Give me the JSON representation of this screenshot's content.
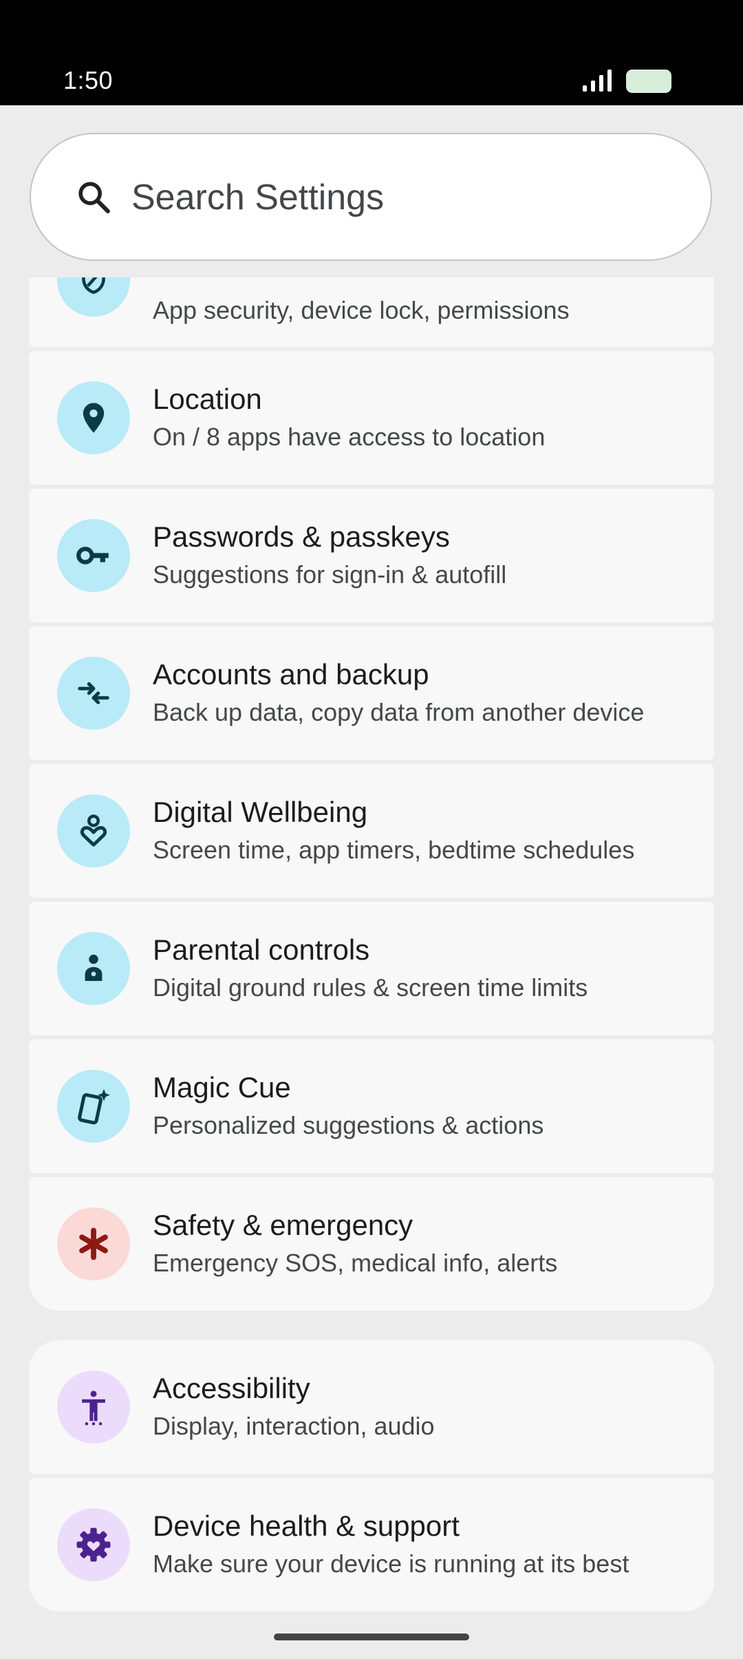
{
  "status_bar": {
    "time": "1:50"
  },
  "search": {
    "placeholder": "Search Settings"
  },
  "colors": {
    "teal_circle": "#b9eaf7",
    "teal_icon": "#0d3a47",
    "red_circle": "#fbd9d6",
    "red_icon": "#8b1a13",
    "purple_circle": "#ecdcfb",
    "purple_icon": "#4d2290"
  },
  "group1": {
    "items": [
      {
        "id": "security",
        "title": "",
        "subtitle": "App security, device lock, permissions",
        "icon": "shield-icon"
      },
      {
        "id": "location",
        "title": "Location",
        "subtitle": "On / 8 apps have access to location",
        "icon": "location-pin-icon"
      },
      {
        "id": "passwords",
        "title": "Passwords & passkeys",
        "subtitle": "Suggestions for sign-in & autofill",
        "icon": "key-icon"
      },
      {
        "id": "accounts",
        "title": "Accounts and backup",
        "subtitle": "Back up data, copy data from another device",
        "icon": "sync-arrows-icon"
      },
      {
        "id": "wellbeing",
        "title": "Digital Wellbeing",
        "subtitle": "Screen time, app timers, bedtime schedules",
        "icon": "wellbeing-heart-icon"
      },
      {
        "id": "parental",
        "title": "Parental controls",
        "subtitle": "Digital ground rules & screen time limits",
        "icon": "child-icon"
      },
      {
        "id": "magic-cue",
        "title": "Magic Cue",
        "subtitle": "Personalized suggestions & actions",
        "icon": "phone-sparkle-icon"
      },
      {
        "id": "safety",
        "title": "Safety & emergency",
        "subtitle": "Emergency SOS, medical info, alerts",
        "icon": "asterisk-icon"
      }
    ]
  },
  "group2": {
    "items": [
      {
        "id": "accessibility",
        "title": "Accessibility",
        "subtitle": "Display, interaction, audio",
        "icon": "accessibility-icon"
      },
      {
        "id": "device-health",
        "title": "Device health & support",
        "subtitle": "Make sure your device is running at its best",
        "icon": "gear-heart-icon"
      }
    ]
  }
}
